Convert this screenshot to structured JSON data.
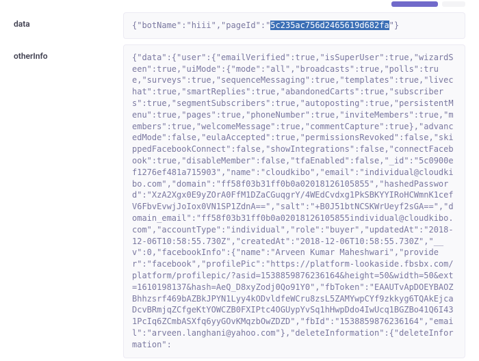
{
  "labels": {
    "data": "data",
    "otherInfo": "otherInfo"
  },
  "fields": {
    "data_pre": "{\"botName\":\"hiii\",\"pageId\":\"",
    "data_highlight": "5c235ac756d2465619d682fa",
    "data_post": "\"}",
    "otherInfo": "{\"data\":{\"user\":{\"emailVerified\":true,\"isSuperUser\":true,\"wizardSeen\":true,\"uiMode\":{\"mode\":\"all\",\"broadcasts\":true,\"polls\":true,\"surveys\":true,\"sequenceMessaging\":true,\"templates\":true,\"livechat\":true,\"smartReplies\":true,\"abandonedCarts\":true,\"subscribers\":true,\"segmentSubscribers\":true,\"autoposting\":true,\"persistentMenu\":true,\"pages\":true,\"phoneNumber\":true,\"inviteMembers\":true,\"members\":true,\"welcomeMessage\":true,\"commentCapture\":true},\"advancedMode\":false,\"eulaAccepted\":true,\"permissionsRevoked\":false,\"skippedFacebookConnect\":false,\"showIntegrations\":false,\"connectFacebook\":true,\"disableMember\":false,\"tfaEnabled\":false,\"_id\":\"5c0900ef1276ef481a715903\",\"name\":\"cloudkibo\",\"email\":\"individual@cloudkibo.com\",\"domain\":\"ff58f03b31ff0b0a02018126105855\",\"hashedPassword\":\"XzA2Xgx0E9yZOrA0FfM1DZaCGuqgrY/4WEdCvdxg1PkSBKYYIRoHCWmnK1cefV6FbvEvwjJoIox0VN1SP1ZdnA==\",\"salt\":\"+B0J51btNCSKWrUeyf2sGA==\",\"domain_email\":\"ff58f03b31ff0b0a02018126105855individual@cloudkibo.com\",\"accountType\":\"individual\",\"role\":\"buyer\",\"updatedAt\":\"2018-12-06T10:58:55.730Z\",\"createdAt\":\"2018-12-06T10:58:55.730Z\",\"__v\":0,\"facebookInfo\":{\"name\":\"Arveen Kumar Maheshwari\",\"provider\":\"facebook\",\"profilePic\":\"https://platform-lookaside.fbsbx.com/platform/profilepic/?asid=1538859876236164&height=50&width=50&ext=1610198137&hash=AeQ_D8xyZodj0Qo91Y0\",\"fbToken\":\"EAAUTvApDOEYBAOZBhhzsrf469bAZBkJPYN1Lyy4kODvldfeWCru8zsL5ZAMYwpCYf9zkkyg6TQAkEjcaDcvBRmjqZCfgeKtYOWCZB0FXIPtc4OGUypYvSq1hHwpDdo4IwUcq1BGZBo41Q6I431PcIq6ZCmbASXfq6yyGOvKMqzbOwZDZD\",\"fbId\":\"1538859876236164\",\"email\":\"arveen.langhani@yahoo.com\"},\"deleteInformation\":{\"deleteInformation\":"
  }
}
